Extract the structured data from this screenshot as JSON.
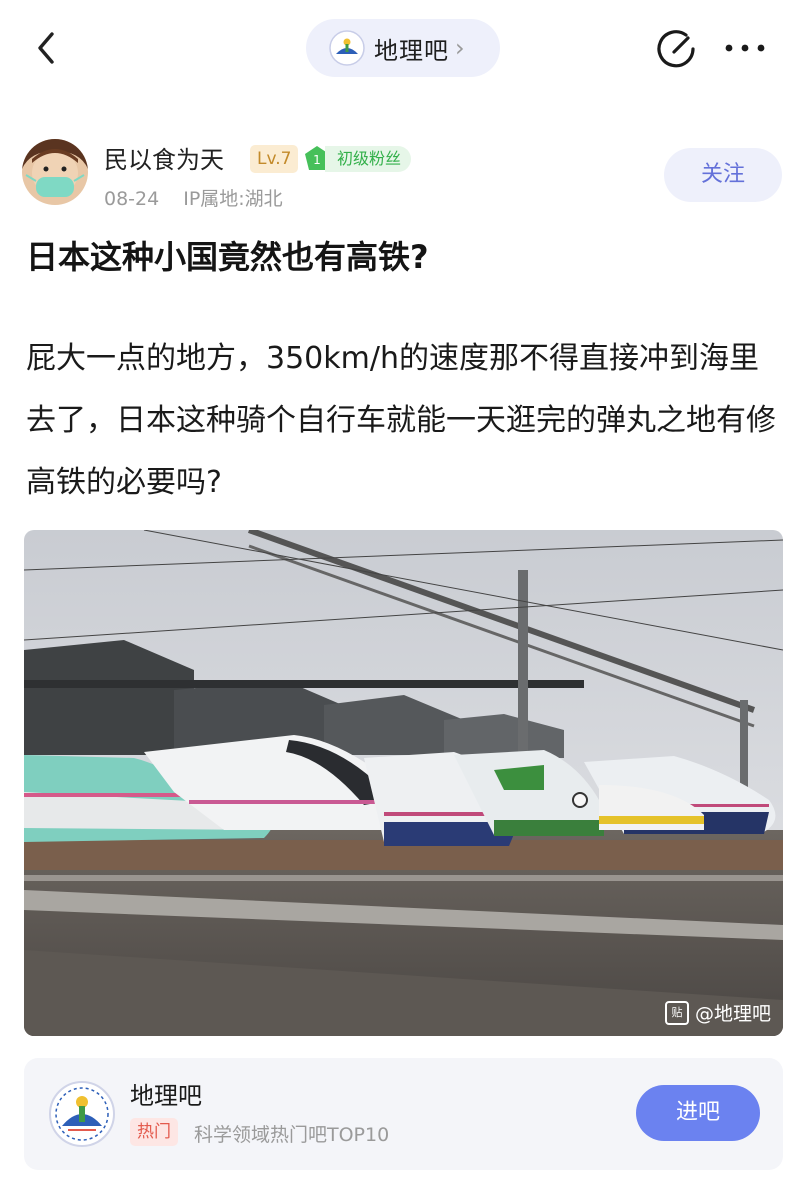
{
  "nav": {
    "forum_name": "地理吧",
    "chevron": "›",
    "icons": {
      "back": "back-arrow-icon",
      "edit": "edit-icon",
      "more": "more-dots-icon"
    }
  },
  "post": {
    "author": {
      "name": "民以食为天",
      "level": "Lv.7",
      "fan_level_number": "1",
      "fan_label": "初级粉丝",
      "date": "08-24",
      "ip_location": "IP属地:湖北"
    },
    "follow_label": "关注",
    "title": "日本这种小国竟然也有高铁?",
    "body": "屁大一点的地方，350km/h的速度那不得直接冲到海里去了，日本这种骑个自行车就能一天逛完的弹丸之地有修高铁的必要吗?",
    "image_watermark": "@地理吧",
    "watermark_icon": "贴"
  },
  "forum_card": {
    "name": "地理吧",
    "hot_tag": "热门",
    "description": "科学领域热门吧TOP10",
    "enter_label": "进吧"
  },
  "colors": {
    "accent": "#6b82f0",
    "pill_bg": "#eef0fb",
    "hot_tag": "#e35a4d",
    "fan_green": "#33b04a",
    "level_gold": "#c38a2a"
  }
}
